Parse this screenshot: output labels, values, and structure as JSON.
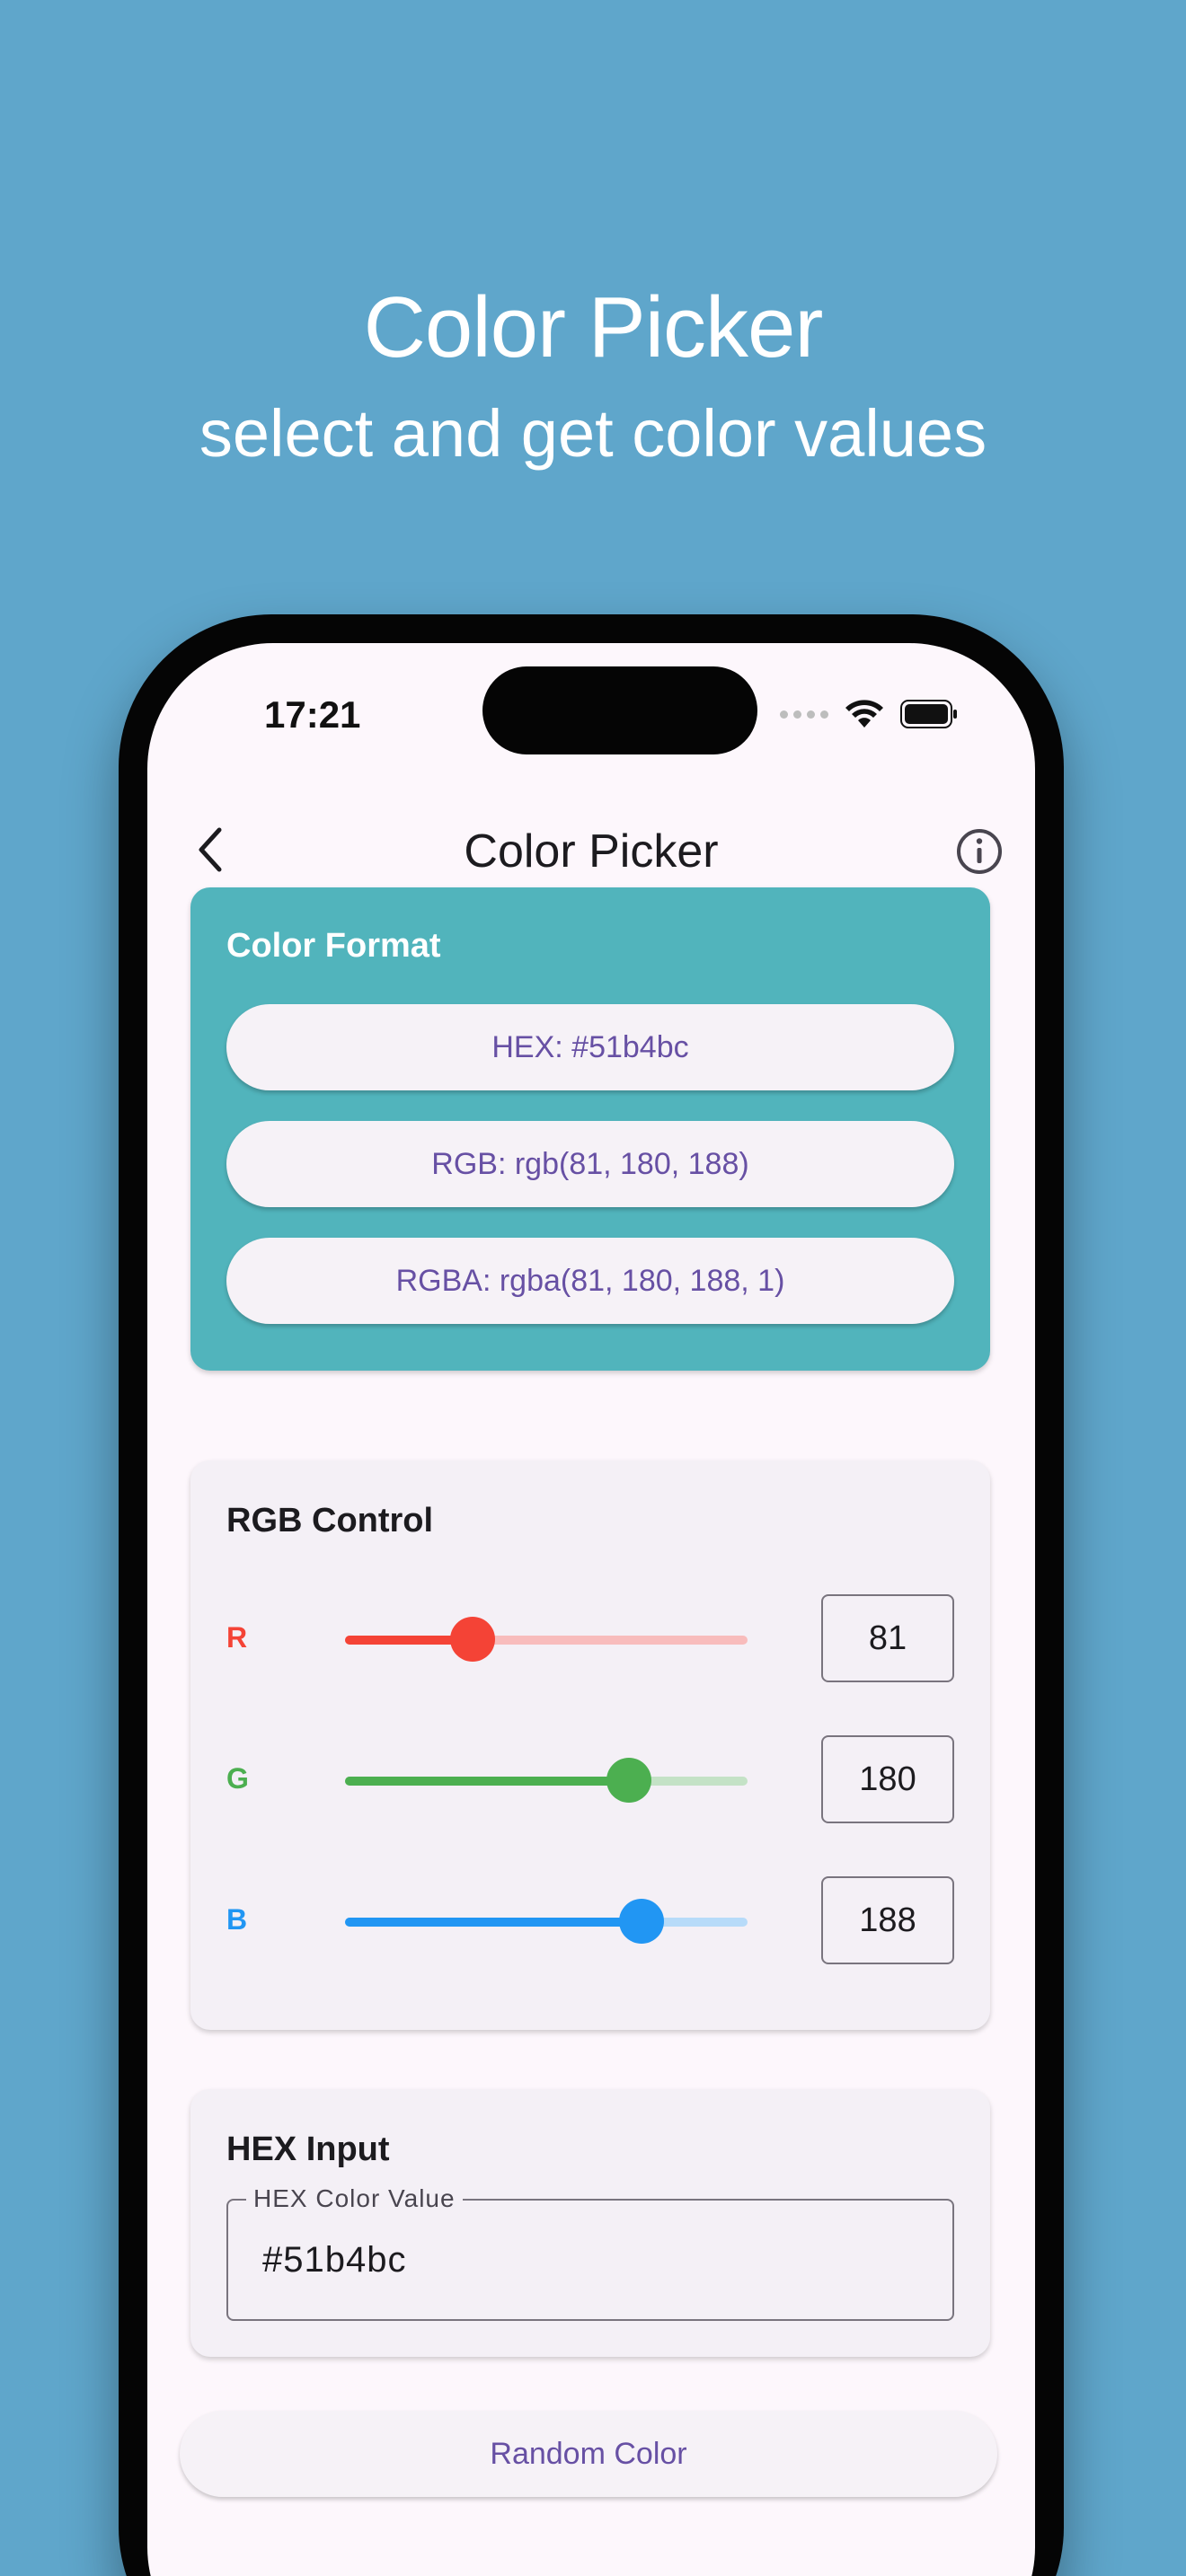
{
  "promo": {
    "title": "Color Picker",
    "subtitle": "select and get color values"
  },
  "status_bar": {
    "time": "17:21",
    "icons": [
      "signal-icon",
      "wifi-icon",
      "battery-icon"
    ]
  },
  "app_bar": {
    "title": "Color Picker",
    "back_icon": "chevron-left-icon",
    "info_icon": "info-icon"
  },
  "color_format": {
    "title": "Color Format",
    "background": "#51b4bc",
    "hex_label": "HEX: #51b4bc",
    "rgb_label": "RGB: rgb(81, 180, 188)",
    "rgba_label": "RGBA: rgba(81, 180, 188, 1)"
  },
  "rgb_control": {
    "title": "RGB Control",
    "channels": [
      {
        "label": "R",
        "value": "81",
        "max": 255,
        "color": "#f44336",
        "track_color": "#f8bcbc"
      },
      {
        "label": "G",
        "value": "180",
        "max": 255,
        "color": "#4caf50",
        "track_color": "#c4e2c6"
      },
      {
        "label": "B",
        "value": "188",
        "max": 255,
        "color": "#2196f3",
        "track_color": "#b7dbf9"
      }
    ]
  },
  "hex_input": {
    "title": "HEX Input",
    "field_label": "HEX Color Value",
    "field_value": "#51b4bc"
  },
  "random_button": {
    "label": "Random Color"
  }
}
